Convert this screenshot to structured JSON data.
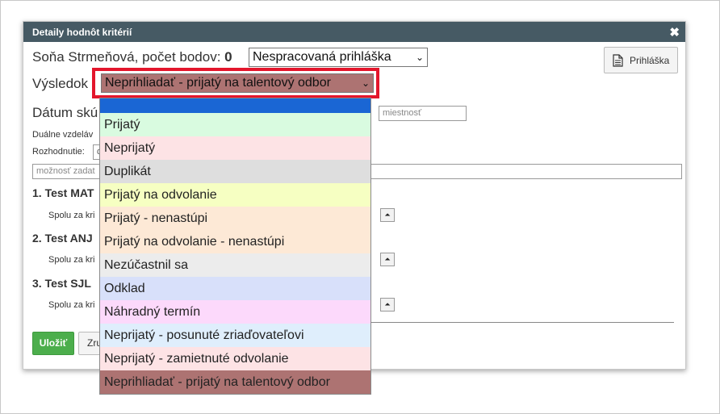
{
  "dialog": {
    "title": "Detaily hodnôt kritérií",
    "close_glyph": "✖",
    "name": "Soňa Strmeňová, počet bodov:",
    "points": "0",
    "status_select": "Nespracovaná prihláška",
    "application_button": "Prihláška",
    "result_label": "Výsledok",
    "result_select": "Neprihliadať - prijatý na talentový odbor",
    "exam_date_label": "Dátum skú",
    "room_placeholder": "miestnosť",
    "dual_label": "Duálne vzdeláv",
    "decision_label": "Rozhodnutie:",
    "decision_value": "d",
    "note_placeholder": "možnosť zadat",
    "tests": [
      {
        "title": "1. Test MAT",
        "sum_label": "Spolu za kri"
      },
      {
        "title": "2. Test ANJ",
        "sum_label": "Spolu za kri"
      },
      {
        "title": "3. Test SJL",
        "sum_label": "Spolu za kri"
      }
    ],
    "save_button": "Uložiť",
    "cancel_button": "Zru",
    "expand_glyph": "⏶"
  },
  "dropdown": {
    "options": [
      {
        "label": "",
        "color": "#1a66d4"
      },
      {
        "label": "Prijatý",
        "color": "#d9fbe0"
      },
      {
        "label": "Neprijatý",
        "color": "#fde3e5"
      },
      {
        "label": "Duplikát",
        "color": "#dedede"
      },
      {
        "label": "Prijatý na odvolanie",
        "color": "#f6ffc2"
      },
      {
        "label": "Prijatý - nenastúpi",
        "color": "#fde9d6"
      },
      {
        "label": "Prijatý na odvolanie - nenastúpi",
        "color": "#fde9d6"
      },
      {
        "label": "Nezúčastnil sa",
        "color": "#ececec"
      },
      {
        "label": "Odklad",
        "color": "#d8e0fa"
      },
      {
        "label": "Náhradný termín",
        "color": "#fcd9fb"
      },
      {
        "label": "Neprijatý - posunuté zriaďovateľovi",
        "color": "#dfeefc"
      },
      {
        "label": "Neprijatý - zamietnuté odvolanie",
        "color": "#fde3e5"
      },
      {
        "label": "Neprihliadať - prijatý na talentový odbor",
        "color": "#ad7372"
      }
    ]
  },
  "colors": {
    "titlebar": "#465a64",
    "highlight": "#e3162c",
    "save": "#4cae4c"
  }
}
